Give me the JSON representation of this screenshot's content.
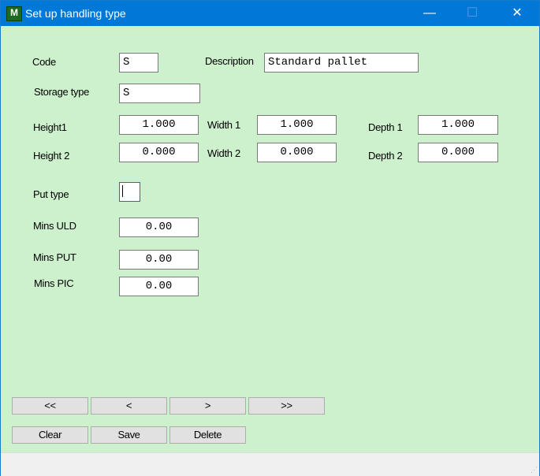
{
  "window": {
    "title": "Set up handling type",
    "minimize": "—",
    "maximize": "☐",
    "close": "✕",
    "logo": "M"
  },
  "form": {
    "code_label": "Code",
    "code": "S",
    "description_label": "Description",
    "description": "Standard pallet",
    "storage_type_label": "Storage type",
    "storage_type": "S",
    "height1_label": "Height1",
    "height1": "1.000",
    "width1_label": "Width 1",
    "width1": "1.000",
    "depth1_label": "Depth 1",
    "depth1": "1.000",
    "height2_label": "Height 2",
    "height2": "0.000",
    "width2_label": "Width 2",
    "width2": "0.000",
    "depth2_label": "Depth 2",
    "depth2": "0.000",
    "put_type_label": "Put type",
    "put_type": "",
    "mins_uld_label": "Mins ULD",
    "mins_uld": "0.00",
    "mins_put_label": "Mins PUT",
    "mins_put": "0.00",
    "mins_pic_label": "Mins PIC",
    "mins_pic": "0.00"
  },
  "nav": {
    "first": "<<",
    "prev": "<",
    "next": ">",
    "last": ">>"
  },
  "actions": {
    "clear": "Clear",
    "save": "Save",
    "delete": "Delete"
  }
}
